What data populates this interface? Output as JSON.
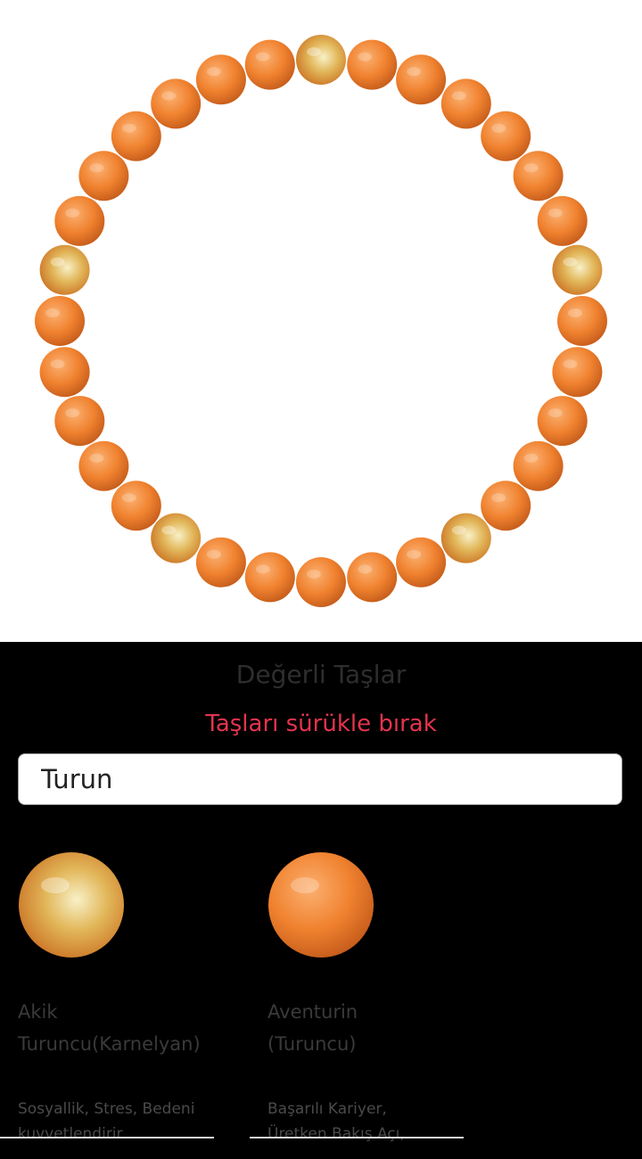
{
  "bracelet": {
    "bead_count": 32,
    "beads": [
      "akik",
      "aventurin",
      "aventurin",
      "aventurin",
      "aventurin",
      "aventurin",
      "aventurin",
      "akik",
      "aventurin",
      "aventurin",
      "aventurin",
      "aventurin",
      "aventurin",
      "akik",
      "aventurin",
      "aventurin",
      "aventurin",
      "aventurin",
      "aventurin",
      "akik",
      "aventurin",
      "aventurin",
      "aventurin",
      "aventurin",
      "aventurin",
      "akik",
      "aventurin",
      "aventurin",
      "aventurin",
      "aventurin",
      "aventurin",
      "aventurin"
    ],
    "colors": {
      "aventurin": {
        "light": "#fbb071",
        "mid": "#f0822f",
        "dark": "#c35a1a"
      },
      "akik": {
        "light": "#f8f1c8",
        "mid": "#e2b75a",
        "dark": "#c86a1c"
      }
    }
  },
  "panel": {
    "title": "Değerli Taşlar",
    "hint": "Taşları sürükle bırak",
    "hint_color": "#e4344e"
  },
  "search": {
    "value": "Turun",
    "placeholder": ""
  },
  "stones": [
    {
      "id": "akik",
      "icon": "agate-stone",
      "name_line1": "Akik",
      "name_line2": "Turuncu(Karnelyan)",
      "desc_line1": "Sosyallik, Stres, Bedeni",
      "desc_line2": "kuvvetlendirir"
    },
    {
      "id": "aventurin",
      "icon": "aventurine-stone",
      "name_line1": "Aventurin",
      "name_line2": "(Turuncu)",
      "desc_line1": "Başarılı Kariyer,",
      "desc_line2": "Üretken Bakış Açı,"
    }
  ]
}
